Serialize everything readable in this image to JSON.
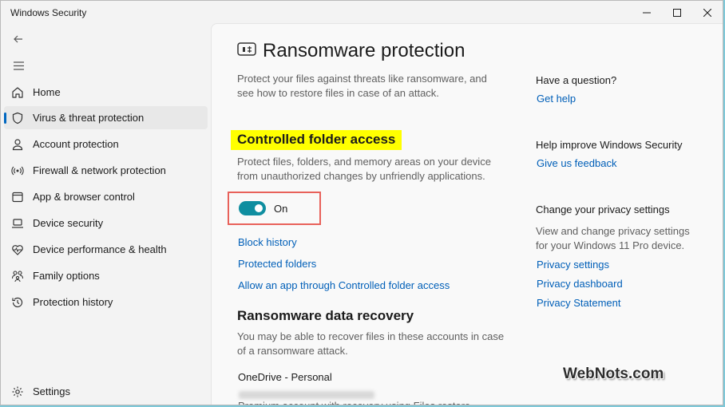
{
  "window": {
    "title": "Windows Security"
  },
  "sidebar": {
    "items": [
      {
        "label": "Home",
        "icon": "home-icon"
      },
      {
        "label": "Virus & threat protection",
        "icon": "shield-icon"
      },
      {
        "label": "Account protection",
        "icon": "person-icon"
      },
      {
        "label": "Firewall & network protection",
        "icon": "wifi-icon"
      },
      {
        "label": "App & browser control",
        "icon": "app-window-icon"
      },
      {
        "label": "Device security",
        "icon": "laptop-icon"
      },
      {
        "label": "Device performance & health",
        "icon": "heart-icon"
      },
      {
        "label": "Family options",
        "icon": "family-icon"
      },
      {
        "label": "Protection history",
        "icon": "history-icon"
      }
    ],
    "settings_label": "Settings"
  },
  "main": {
    "title": "Ransomware protection",
    "intro": "Protect your files against threats like ransomware, and see how to restore files in case of an attack.",
    "cfa": {
      "heading": "Controlled folder access",
      "description": "Protect files, folders, and memory areas on your device from unauthorized changes by unfriendly applications.",
      "toggle_state": "On",
      "toggle_on": true,
      "links": [
        "Block history",
        "Protected folders",
        "Allow an app through Controlled folder access"
      ]
    },
    "recovery": {
      "heading": "Ransomware data recovery",
      "description": "You may be able to recover files in these accounts in case of a ransomware attack.",
      "account": "OneDrive - Personal",
      "account_detail": "Premium account with recovery using Files restore"
    }
  },
  "right": {
    "question_head": "Have a question?",
    "get_help": "Get help",
    "improve_head": "Help improve Windows Security",
    "feedback": "Give us feedback",
    "privacy_head": "Change your privacy settings",
    "privacy_desc": "View and change privacy settings for your Windows 11 Pro device.",
    "privacy_links": [
      "Privacy settings",
      "Privacy dashboard",
      "Privacy Statement"
    ]
  },
  "watermark": "WebNots.com",
  "colors": {
    "accent": "#0067c0",
    "toggle": "#0f8ea0",
    "highlight": "#ffff00",
    "callout_border": "#e8615a"
  }
}
